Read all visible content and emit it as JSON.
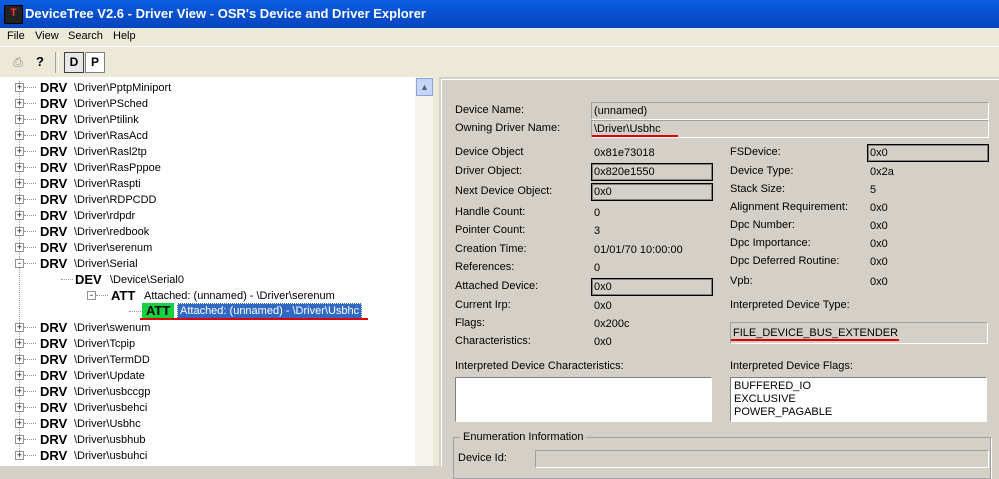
{
  "window": {
    "title": "DeviceTree V2.6 - Driver View - OSR's Device and Driver Explorer",
    "icon": "app-icon"
  },
  "menu": [
    "File",
    "View",
    "Search",
    "Help"
  ],
  "toolbar": {
    "print_icon": "printer-icon",
    "help_icon": "help-icon",
    "d_label": "D",
    "p_label": "P"
  },
  "tree": {
    "drivers_before": [
      {
        "kind": "DRV",
        "name": "\\Driver\\PptpMiniport"
      },
      {
        "kind": "DRV",
        "name": "\\Driver\\PSched"
      },
      {
        "kind": "DRV",
        "name": "\\Driver\\Ptilink"
      },
      {
        "kind": "DRV",
        "name": "\\Driver\\RasAcd"
      },
      {
        "kind": "DRV",
        "name": "\\Driver\\Rasl2tp"
      },
      {
        "kind": "DRV",
        "name": "\\Driver\\RasPppoe"
      },
      {
        "kind": "DRV",
        "name": "\\Driver\\Raspti"
      },
      {
        "kind": "DRV",
        "name": "\\Driver\\RDPCDD"
      },
      {
        "kind": "DRV",
        "name": "\\Driver\\rdpdr"
      },
      {
        "kind": "DRV",
        "name": "\\Driver\\redbook"
      },
      {
        "kind": "DRV",
        "name": "\\Driver\\serenum"
      },
      {
        "kind": "DRV",
        "name": "\\Driver\\Serial"
      }
    ],
    "dev": {
      "kind": "DEV",
      "name": "\\Device\\Serial0"
    },
    "att1": {
      "kind": "ATT",
      "name": "Attached: (unnamed) - \\Driver\\serenum"
    },
    "att2": {
      "kind": "ATT",
      "name": "Attached: (unnamed) - \\Driver\\Usbhc"
    },
    "drivers_after": [
      {
        "kind": "DRV",
        "name": "\\Driver\\swenum"
      },
      {
        "kind": "DRV",
        "name": "\\Driver\\Tcpip"
      },
      {
        "kind": "DRV",
        "name": "\\Driver\\TermDD"
      },
      {
        "kind": "DRV",
        "name": "\\Driver\\Update"
      },
      {
        "kind": "DRV",
        "name": "\\Driver\\usbccgp"
      },
      {
        "kind": "DRV",
        "name": "\\Driver\\usbehci"
      },
      {
        "kind": "DRV",
        "name": "\\Driver\\Usbhc"
      },
      {
        "kind": "DRV",
        "name": "\\Driver\\usbhub"
      },
      {
        "kind": "DRV",
        "name": "\\Driver\\usbuhci"
      }
    ]
  },
  "details": {
    "device_name": {
      "label": "Device Name:",
      "value": "(unnamed)"
    },
    "owning_driver": {
      "label": "Owning Driver Name:",
      "value": "\\Driver\\Usbhc"
    },
    "left": [
      {
        "label": "Device Object",
        "value": "0x81e73018"
      },
      {
        "label": "Driver Object:",
        "value": "0x820e1550"
      },
      {
        "label": "Next Device Object:",
        "value": "0x0"
      },
      {
        "label": "Handle Count:",
        "value": "0"
      },
      {
        "label": "Pointer Count:",
        "value": "3"
      },
      {
        "label": "Creation Time:",
        "value": "01/01/70 10:00:00"
      },
      {
        "label": "References:",
        "value": "0"
      },
      {
        "label": "Attached Device:",
        "value": "0x0"
      },
      {
        "label": "Current Irp:",
        "value": "0x0"
      },
      {
        "label": "Flags:",
        "value": "0x200c"
      },
      {
        "label": "Characteristics:",
        "value": "0x0"
      }
    ],
    "right": [
      {
        "label": "FSDevice:",
        "value": "0x0"
      },
      {
        "label": "Device Type:",
        "value": "0x2a"
      },
      {
        "label": "Stack Size:",
        "value": "5"
      },
      {
        "label": "Alignment Requirement:",
        "value": "0x0"
      },
      {
        "label": "Dpc Number:",
        "value": "0x0"
      },
      {
        "label": "Dpc Importance:",
        "value": "0x0"
      },
      {
        "label": "Dpc Deferred Routine:",
        "value": "0x0"
      },
      {
        "label": "Vpb:",
        "value": "0x0"
      }
    ],
    "interpreted_type": {
      "label": "Interpreted Device Type:",
      "value": "FILE_DEVICE_BUS_EXTENDER"
    },
    "interpreted_chars": {
      "label": "Interpreted Device Characteristics:"
    },
    "interpreted_flags": {
      "label": "Interpreted Device Flags:",
      "values": [
        "BUFFERED_IO",
        "EXCLUSIVE",
        "POWER_PAGABLE"
      ]
    },
    "enumeration": {
      "legend": "Enumeration Information",
      "device_id_label": "Device Id:"
    }
  },
  "colors": {
    "title_bar": "#0852d4",
    "att_badge": "#13d13f",
    "selection": "#316ac5",
    "annotation": "#dd0000"
  }
}
